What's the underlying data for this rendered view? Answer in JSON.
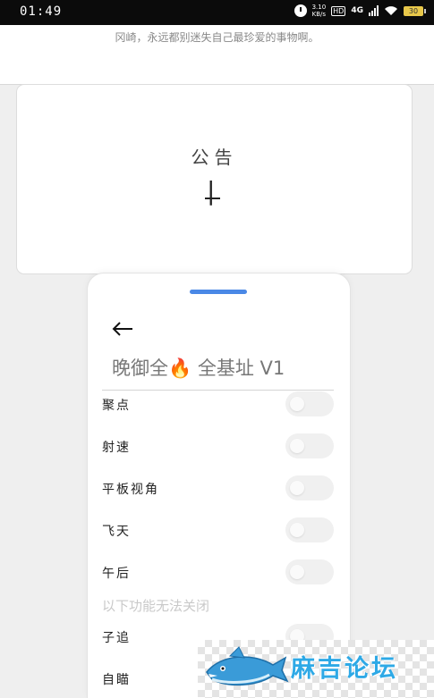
{
  "status_bar": {
    "time": "01:49",
    "speed_value": "3.10",
    "speed_unit": "KB/s",
    "hd": "HD",
    "network": "4G",
    "battery": "30"
  },
  "banner": {
    "quote": "冈崎，永远都别迷失自己最珍爱的事物啊。"
  },
  "notice": {
    "title": "公告",
    "caret": "|"
  },
  "panel": {
    "back_icon": "arrow-left-icon",
    "title_prefix": "晚御全",
    "title_emoji": "🔥",
    "title_suffix": "全基址 V1",
    "handle_color": "#4a88e6",
    "toggles": [
      {
        "label": "聚点",
        "on": false
      },
      {
        "label": "射速",
        "on": false
      },
      {
        "label": "平板视角",
        "on": false
      },
      {
        "label": "飞天",
        "on": false
      },
      {
        "label": "午后",
        "on": false
      }
    ],
    "section_note": "以下功能无法关闭",
    "locked_toggles": [
      {
        "label": "子追",
        "on": false
      },
      {
        "label": "自瞄",
        "on": false
      }
    ]
  },
  "watermark": {
    "text": "麻吉论坛",
    "color": "#2ea9e6"
  }
}
